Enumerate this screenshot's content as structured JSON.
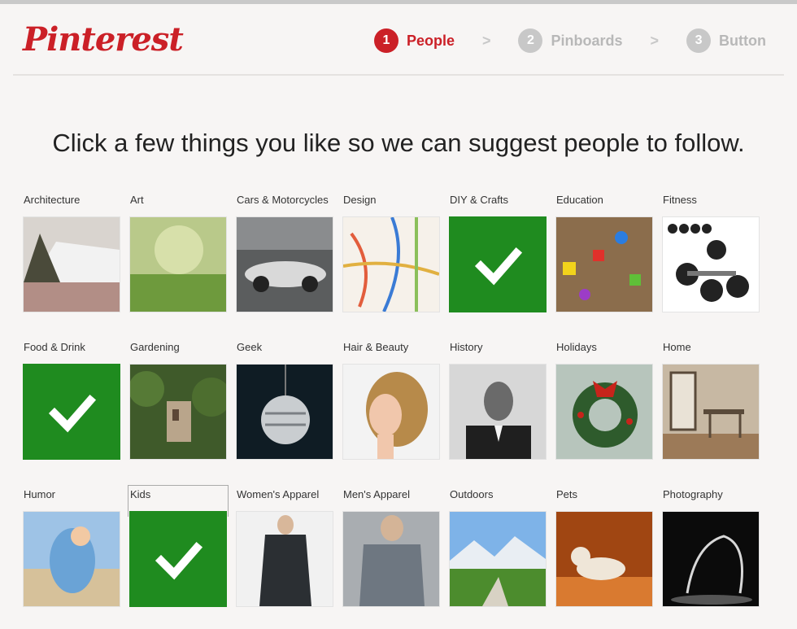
{
  "brand": {
    "logo_text": "Pinterest"
  },
  "steps": [
    {
      "num": "1",
      "label": "People",
      "active": true
    },
    {
      "num": "2",
      "label": "Pinboards",
      "active": false
    },
    {
      "num": "3",
      "label": "Button",
      "active": false
    }
  ],
  "step_separator": ">",
  "headline": "Click a few things you like so we can suggest people to follow.",
  "categories": [
    {
      "label": "Architecture",
      "selected": false
    },
    {
      "label": "Art",
      "selected": false
    },
    {
      "label": "Cars & Motorcycles",
      "selected": false
    },
    {
      "label": "Design",
      "selected": false
    },
    {
      "label": "DIY & Crafts",
      "selected": true
    },
    {
      "label": "Education",
      "selected": false
    },
    {
      "label": "Fitness",
      "selected": false
    },
    {
      "label": "Food & Drink",
      "selected": true
    },
    {
      "label": "Gardening",
      "selected": false
    },
    {
      "label": "Geek",
      "selected": false
    },
    {
      "label": "Hair & Beauty",
      "selected": false
    },
    {
      "label": "History",
      "selected": false
    },
    {
      "label": "Holidays",
      "selected": false
    },
    {
      "label": "Home",
      "selected": false
    },
    {
      "label": "Humor",
      "selected": false
    },
    {
      "label": "Kids",
      "selected": true
    },
    {
      "label": "Women's Apparel",
      "selected": false
    },
    {
      "label": "Men's Apparel",
      "selected": false
    },
    {
      "label": "Outdoors",
      "selected": false
    },
    {
      "label": "Pets",
      "selected": false
    },
    {
      "label": "Photography",
      "selected": false
    }
  ],
  "colors": {
    "brand_red": "#cb2027",
    "selected_green": "#1f8b1f",
    "inactive_gray": "#c8c8c8"
  }
}
